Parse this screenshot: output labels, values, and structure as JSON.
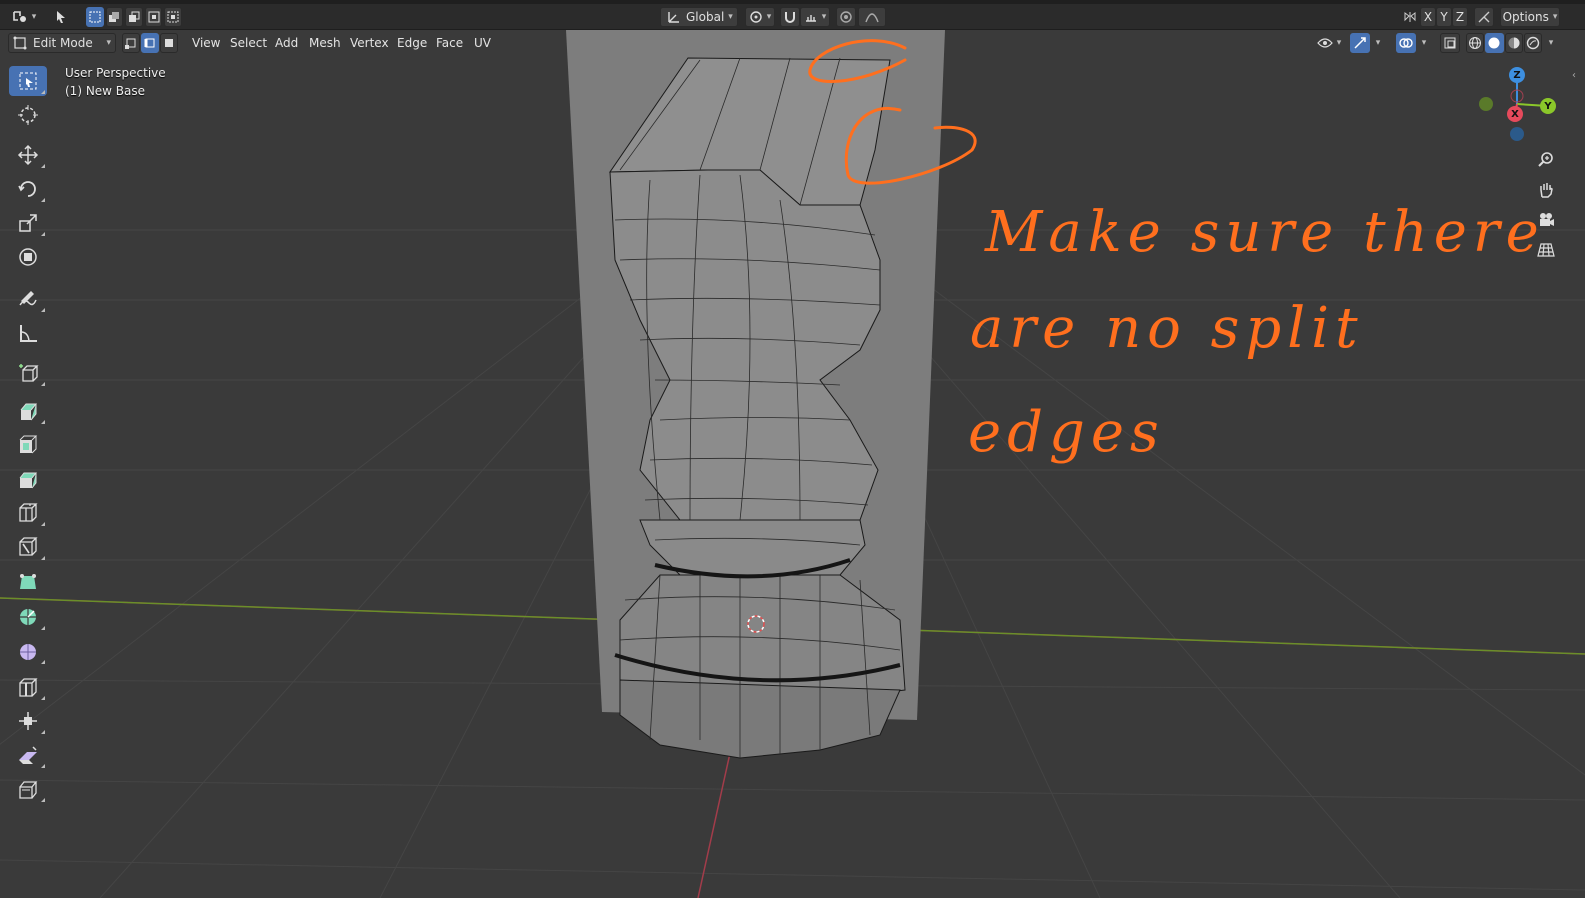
{
  "header": {
    "orientation": "Global",
    "axes": [
      "X",
      "Y",
      "Z"
    ],
    "options_label": "Options"
  },
  "mode_bar": {
    "mode": "Edit Mode",
    "menus": [
      "View",
      "Select",
      "Add",
      "Mesh",
      "Vertex",
      "Edge",
      "Face",
      "UV"
    ]
  },
  "viewport": {
    "perspective_label": "User Perspective",
    "object_label": "(1) New Base"
  },
  "gizmo": {
    "z": "Z",
    "y": "Y",
    "x": "X"
  },
  "annotation": {
    "line1": "Make sure there",
    "line2": "are no split",
    "line3": "edges"
  },
  "colors": {
    "accent": "#4772b3",
    "annotation": "#ff6f1e",
    "x_axis": "#e64a5c",
    "y_axis": "#8bc72a",
    "z_axis": "#3d8fe0"
  }
}
